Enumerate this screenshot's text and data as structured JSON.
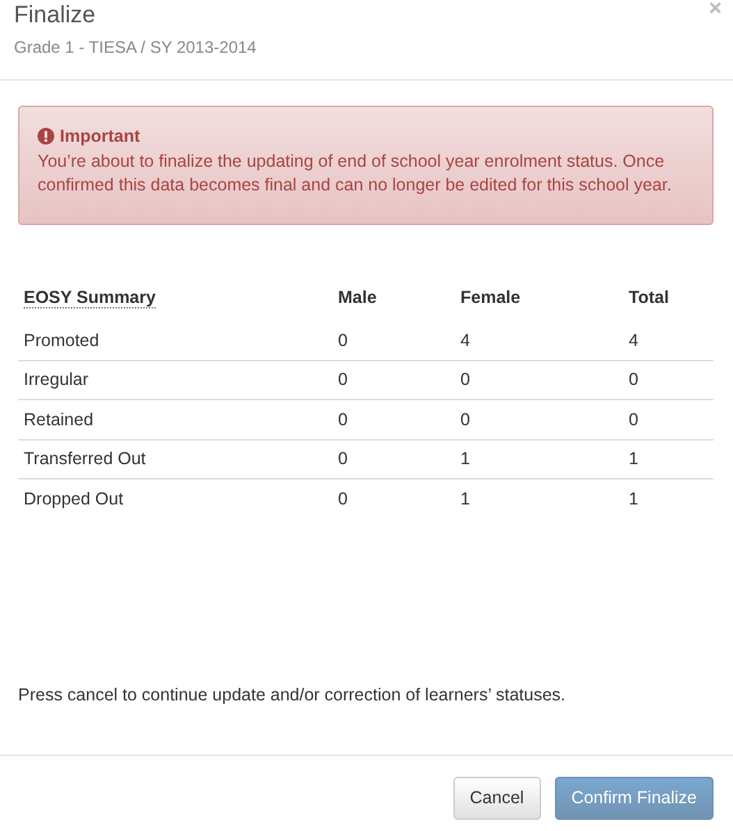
{
  "dialog": {
    "title": "Finalize",
    "subtitle": "Grade 1 - TIESA / SY 2013-2014",
    "close": "×"
  },
  "alert": {
    "title": "Important",
    "message": "You’re about to finalize the updating of end of school year enrolment status. Once confirmed this data becomes final and can no longer be edited for this school year."
  },
  "table": {
    "columns": [
      "EOSY Summary",
      "Male",
      "Female",
      "Total"
    ],
    "rows": [
      [
        "Promoted",
        "0",
        "4",
        "4"
      ],
      [
        "Irregular",
        "0",
        "0",
        "0"
      ],
      [
        "Retained",
        "0",
        "0",
        "0"
      ],
      [
        "Transferred Out",
        "0",
        "1",
        "1"
      ],
      [
        "Dropped Out",
        "0",
        "1",
        "1"
      ]
    ]
  },
  "note": "Press cancel to continue update and/or correction of learners’ statuses.",
  "buttons": [
    {
      "label": "Cancel",
      "kind": "default",
      "disabled": false
    },
    {
      "label": "Confirm Finalize",
      "kind": "primary",
      "disabled": true
    }
  ]
}
